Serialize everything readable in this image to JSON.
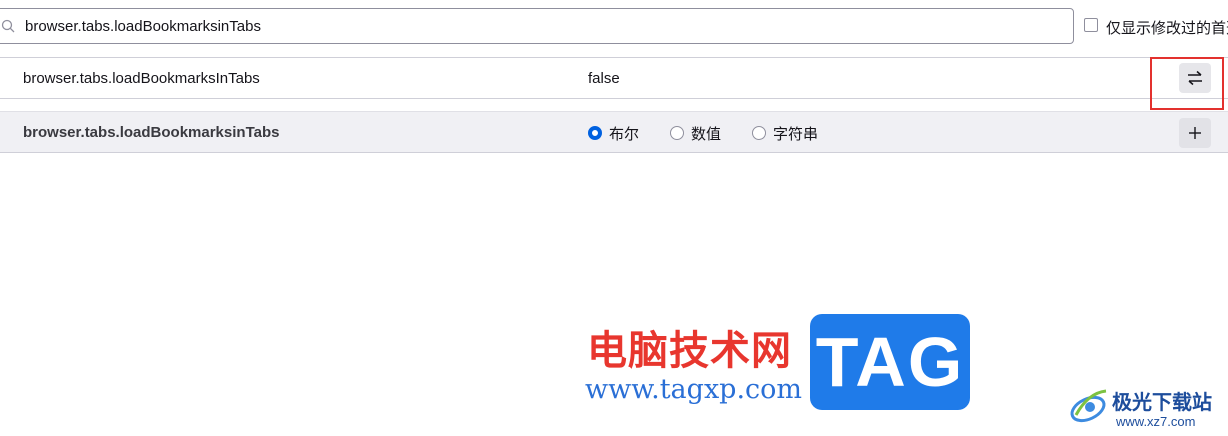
{
  "search": {
    "value": "browser.tabs.loadBookmarksinTabs"
  },
  "filter": {
    "modified_only_label": "仅显示修改过的首选项",
    "checked": false
  },
  "existing_pref": {
    "name": "browser.tabs.loadBookmarksInTabs",
    "value": "false",
    "action_icon": "toggle-icon"
  },
  "new_pref": {
    "name": "browser.tabs.loadBookmarksinTabs",
    "types": [
      {
        "label": "布尔",
        "selected": true
      },
      {
        "label": "数值",
        "selected": false
      },
      {
        "label": "字符串",
        "selected": false
      }
    ],
    "action_icon": "plus-icon"
  },
  "colors": {
    "accent": "#0061e0",
    "highlight": "#e3312e"
  },
  "watermark": {
    "cn_title": "电脑技术网",
    "url": "www.tagxp.com",
    "tag": "TAG",
    "site_name": "极光下载站",
    "site_url": "www.xz7.com"
  }
}
